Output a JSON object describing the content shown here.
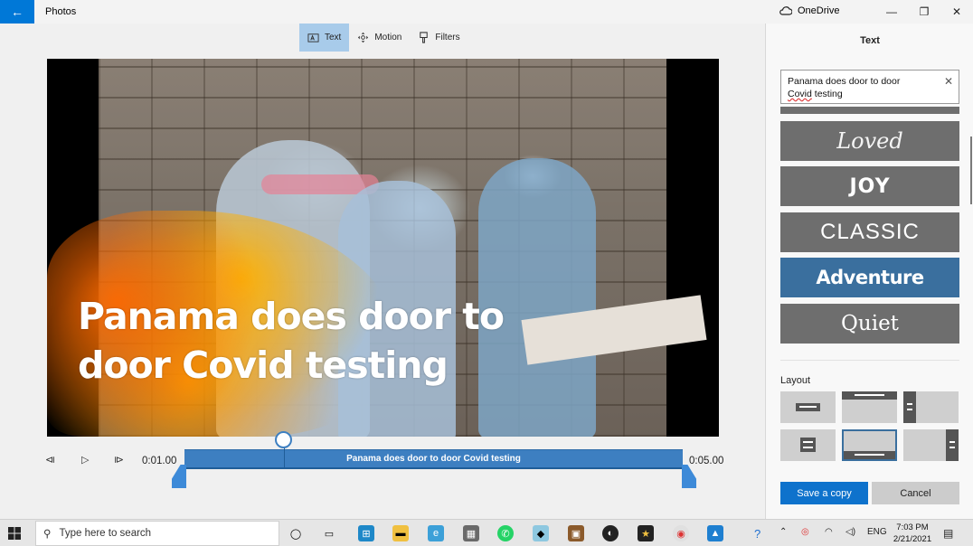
{
  "window": {
    "title": "Photos",
    "onedrive_label": "OneDrive",
    "back_glyph": "←",
    "minimize_glyph": "—",
    "maximize_glyph": "❐",
    "close_glyph": "✕"
  },
  "toolbar": {
    "tabs": [
      {
        "label": "Text",
        "icon": "text-icon",
        "active": true
      },
      {
        "label": "Motion",
        "icon": "motion-icon",
        "active": false
      },
      {
        "label": "Filters",
        "icon": "filters-icon",
        "active": false
      }
    ]
  },
  "video": {
    "caption": "Panama does door to door Covid testing"
  },
  "timeline": {
    "start_time": "0:01.00",
    "end_time": "0:05.00",
    "clip_label": "Panama does door to door Covid testing",
    "playhead_fraction": 0.2
  },
  "panel": {
    "title": "Text",
    "text_value_line1": "Panama does door to door",
    "text_value_line2_word": "Covid",
    "text_value_line2_rest": " testing",
    "clear_glyph": "✕",
    "styles": [
      {
        "label": "Loved",
        "selected": false
      },
      {
        "label": "JOY",
        "selected": false
      },
      {
        "label": "CLASSIC",
        "selected": false
      },
      {
        "label": "Adventure",
        "selected": true
      },
      {
        "label": "Quiet",
        "selected": false
      }
    ],
    "layout_label": "Layout",
    "selected_layout_index": 4,
    "save_label": "Save a copy",
    "cancel_label": "Cancel"
  },
  "taskbar": {
    "search_placeholder": "Type here to search",
    "language": "ENG",
    "time": "7:03 PM",
    "date": "2/21/2021"
  },
  "colors": {
    "accent": "#0078d7",
    "selected_style": "#3a6f9e",
    "timeline": "#3d7fc1"
  }
}
